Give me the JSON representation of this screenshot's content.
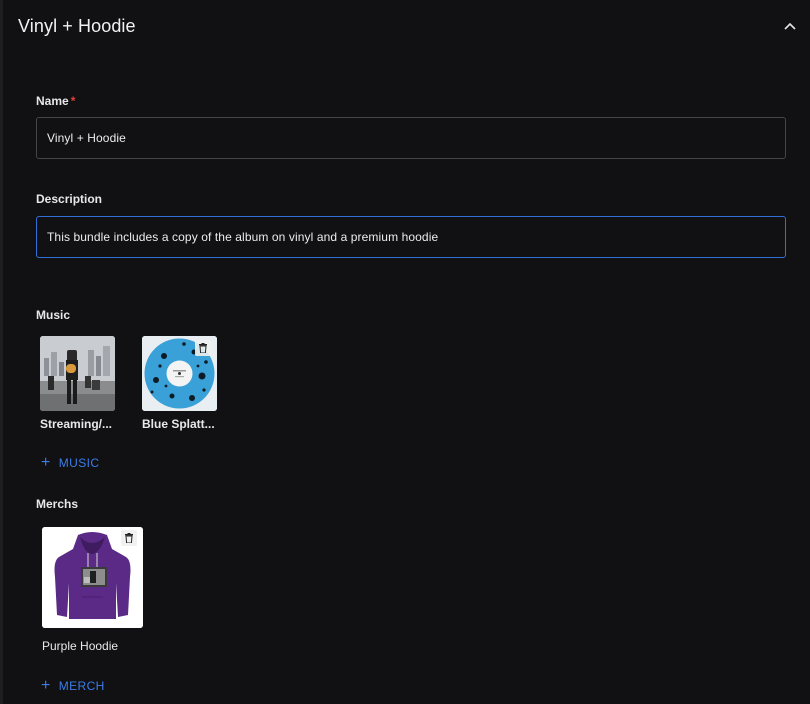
{
  "header": {
    "title": "Vinyl + Hoodie",
    "collapse_icon": "chevron-up-icon"
  },
  "form": {
    "name_label": "Name",
    "name_required": "*",
    "name_value": "Vinyl + Hoodie",
    "description_label": "Description",
    "description_value": "This bundle includes a copy of the album on vinyl and a premium hoodie"
  },
  "music": {
    "section_label": "Music",
    "items": [
      {
        "label": "Streaming/..."
      },
      {
        "label": "Blue Splatt..."
      }
    ],
    "add_label": "MUSIC"
  },
  "merchs": {
    "section_label": "Merchs",
    "items": [
      {
        "label": "Purple Hoodie"
      }
    ],
    "add_label": "MERCH"
  },
  "colors": {
    "accent": "#3b7de8",
    "focus_border": "#2f6fd6",
    "required": "#e0423a",
    "hoodie": "#5b2a86",
    "vinyl": "#3aa0d8"
  }
}
